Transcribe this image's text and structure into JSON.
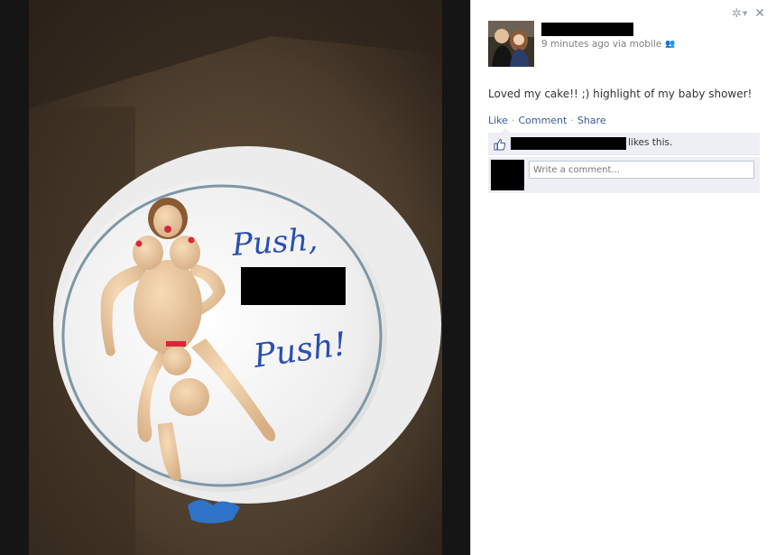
{
  "photo": {
    "cake_text_line1": "Push,",
    "cake_text_line3": "Push!",
    "box_color": "#4a3a2a",
    "icing_color": "#f6f6f6",
    "writing_color": "#2a4fb0"
  },
  "post": {
    "meta_time": "9 minutes ago via mobile",
    "text": "Loved my cake!! ;) highlight of my baby shower!",
    "actions": {
      "like": "Like",
      "comment": "Comment",
      "share": "Share",
      "separator": "·"
    },
    "likes_suffix": "likes this.",
    "comment_placeholder": "Write a comment..."
  },
  "controls": {
    "gear_icon": "gear-icon",
    "close_glyph": "✕"
  },
  "colors": {
    "link": "#3b5998",
    "ufi_bg": "#edeff4",
    "redaction": "#000000"
  }
}
